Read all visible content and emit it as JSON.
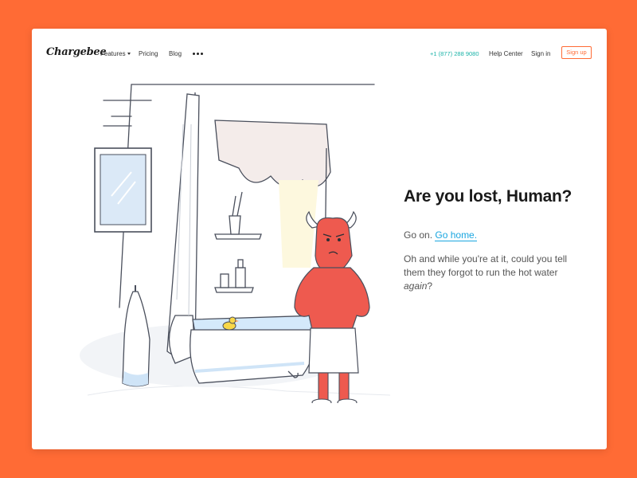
{
  "nav": {
    "logo": "Chargebee",
    "features": "Features",
    "pricing": "Pricing",
    "blog": "Blog",
    "phone": "+1 (877) 288 9080",
    "help": "Help Center",
    "signin": "Sign in",
    "signup": "Sign up"
  },
  "hero": {
    "headline": "Are you lost, Human?",
    "go_on": "Go on.",
    "go_home": "Go home.",
    "para_main": "Oh and while you're at it, could you tell them they forgot to run the hot water ",
    "para_em": "again",
    "para_end": "?"
  },
  "colors": {
    "background": "#FF6B35",
    "accent": "#1aa6e0",
    "phone": "#1bb3a8",
    "monster": "#ee5a4f"
  }
}
